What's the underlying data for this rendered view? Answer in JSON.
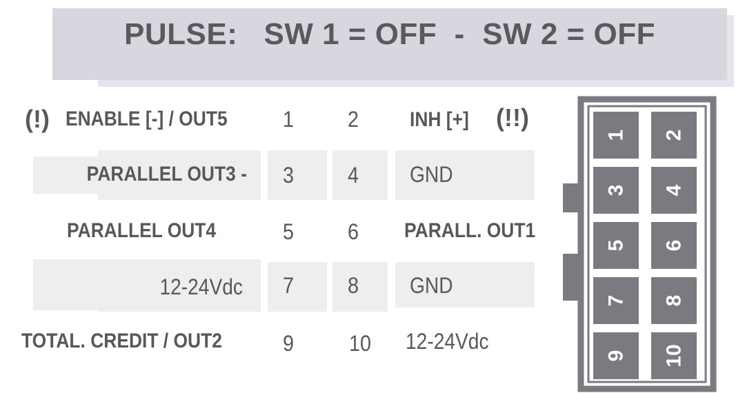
{
  "title": "PULSE:   SW 1 = OFF  -  SW 2 = OFF",
  "rows": [
    {
      "left_label": "ENABLE [-] / OUT5",
      "left_pin": "1",
      "right_pin": "2",
      "right_label": "INH [+]"
    },
    {
      "left_label": "PARALLEL OUT3 -",
      "left_pin": "3",
      "right_pin": "4",
      "right_label": "GND"
    },
    {
      "left_label": "PARALLEL OUT4",
      "left_pin": "5",
      "right_pin": "6",
      "right_label": "PARALL. OUT1"
    },
    {
      "left_label": "12-24Vdc",
      "left_pin": "7",
      "right_pin": "8",
      "right_label": "GND"
    },
    {
      "left_label": "TOTAL. CREDIT / OUT2",
      "left_pin": "9",
      "right_pin": "10",
      "right_label": "12-24Vdc"
    }
  ],
  "warnings": {
    "left": "(!)",
    "right": "(!!)"
  },
  "connector": {
    "pins": [
      "1",
      "2",
      "3",
      "4",
      "5",
      "6",
      "7",
      "8",
      "9",
      "10"
    ],
    "pin_color": "#7a7b80",
    "frame_color": "#7a7b80"
  }
}
